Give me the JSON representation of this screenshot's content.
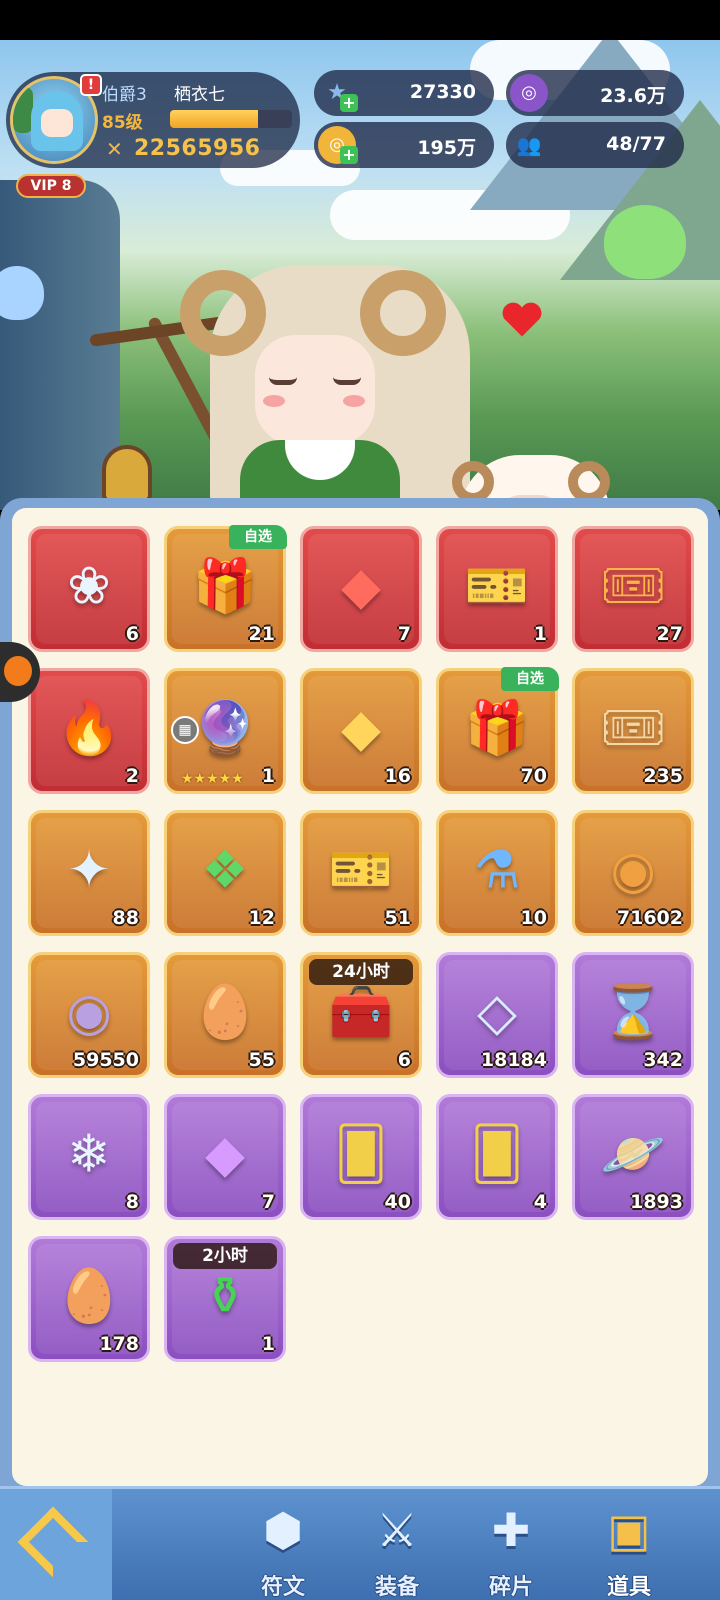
{
  "player": {
    "rank": "伯爵3",
    "name": "栖衣七",
    "level": "85级",
    "power": "22565956",
    "vip": "VIP 8",
    "alert": "!",
    "xp_fraction": 0.72
  },
  "currencies": [
    {
      "id": "star",
      "value": "27330",
      "icon": "star-gem-icon",
      "color": "#8ab8e8",
      "has_plus": true
    },
    {
      "id": "purple-coin",
      "value": "23.6万",
      "icon": "purple-coin-icon",
      "color": "#8a55c9",
      "has_plus": false
    },
    {
      "id": "gold",
      "value": "195万",
      "icon": "gold-coin-icon",
      "color": "#f1b53a",
      "has_plus": true
    },
    {
      "id": "friends",
      "value": "48/77",
      "icon": "people-icon",
      "color": "#e6eaf3",
      "has_plus": false
    }
  ],
  "items": [
    {
      "name": "lotus-gem",
      "glyph": "❀",
      "color": "#e9f4ff",
      "rarity": "red",
      "count": "6"
    },
    {
      "name": "crystal-gift-box",
      "glyph": "🎁",
      "color": "#ffe08a",
      "rarity": "gold",
      "count": "21",
      "tag": "自选"
    },
    {
      "name": "red-rune-crystal",
      "glyph": "◆",
      "color": "#ff6b5c",
      "rarity": "red",
      "count": "7"
    },
    {
      "name": "blue-ticket",
      "glyph": "🎫",
      "color": "#8ea0ff",
      "rarity": "red",
      "count": "1"
    },
    {
      "name": "sun-ticket",
      "glyph": "🎟",
      "color": "#ffb24a",
      "rarity": "red",
      "count": "27"
    },
    {
      "name": "fire-egg",
      "glyph": "🔥",
      "color": "#ff8a2a",
      "rarity": "red",
      "count": "2"
    },
    {
      "name": "crystal-ball",
      "glyph": "🔮",
      "color": "#ffd04a",
      "rarity": "gold",
      "count": "1",
      "stars": "★★★★★",
      "grid_button": true
    },
    {
      "name": "gold-rune-crystal",
      "glyph": "◆",
      "color": "#ffd55c",
      "rarity": "gold",
      "count": "16"
    },
    {
      "name": "crystal-gift-box-2",
      "glyph": "🎁",
      "color": "#ffe08a",
      "rarity": "gold",
      "count": "70",
      "tag": "自选"
    },
    {
      "name": "gold-ticket",
      "glyph": "🎟",
      "color": "#f3d7a6",
      "rarity": "gold",
      "count": "235"
    },
    {
      "name": "star-crystal",
      "glyph": "✦",
      "color": "#e4f1ff",
      "rarity": "gold",
      "count": "88"
    },
    {
      "name": "green-crystal",
      "glyph": "❖",
      "color": "#5fd86a",
      "rarity": "gold",
      "count": "12"
    },
    {
      "name": "heart-ticket",
      "glyph": "🎫",
      "color": "#7fe3e8",
      "rarity": "gold",
      "count": "51"
    },
    {
      "name": "potion-flask",
      "glyph": "⚗",
      "color": "#6fb8ff",
      "rarity": "gold",
      "count": "10"
    },
    {
      "name": "gold-medal-coin",
      "glyph": "◉",
      "color": "#f0a040",
      "rarity": "gold",
      "count": "71602"
    },
    {
      "name": "silver-coin",
      "glyph": "◉",
      "color": "#b9a0e0",
      "rarity": "gold",
      "count": "59550"
    },
    {
      "name": "swirl-egg",
      "glyph": "🥚",
      "color": "#d97a35",
      "rarity": "gold",
      "count": "55"
    },
    {
      "name": "treasure-chest",
      "glyph": "🧰",
      "color": "#e7a54a",
      "rarity": "gold",
      "count": "6",
      "timer": "24小时"
    },
    {
      "name": "diamond-gem",
      "glyph": "◇",
      "color": "#d9ebff",
      "rarity": "purple",
      "count": "18184"
    },
    {
      "name": "hourglass",
      "glyph": "⌛",
      "color": "#c8d7ff",
      "rarity": "purple",
      "count": "342"
    },
    {
      "name": "ice-crystals",
      "glyph": "❄",
      "color": "#e8f4ff",
      "rarity": "purple",
      "count": "8"
    },
    {
      "name": "purple-rune-crystal",
      "glyph": "◆",
      "color": "#d79bff",
      "rarity": "purple",
      "count": "7"
    },
    {
      "name": "sword-card",
      "glyph": "🂠",
      "color": "#f2cf48",
      "rarity": "purple",
      "count": "40"
    },
    {
      "name": "refresh-card",
      "glyph": "🂠",
      "color": "#f2cf48",
      "rarity": "purple",
      "count": "4"
    },
    {
      "name": "planet-orb",
      "glyph": "🪐",
      "color": "#78d6e0",
      "rarity": "purple",
      "count": "1893"
    },
    {
      "name": "purple-egg",
      "glyph": "🥚",
      "color": "#9b52e0",
      "rarity": "purple",
      "count": "178"
    },
    {
      "name": "green-potion",
      "glyph": "⚱",
      "color": "#45d454",
      "rarity": "purple",
      "count": "1",
      "timer": "2小时"
    }
  ],
  "nav": [
    {
      "id": "runes",
      "label": "符文",
      "glyph": "⬢",
      "active": false
    },
    {
      "id": "equipment",
      "label": "装备",
      "glyph": "⚔",
      "active": false
    },
    {
      "id": "fragments",
      "label": "碎片",
      "glyph": "✚",
      "active": false
    },
    {
      "id": "items",
      "label": "道具",
      "glyph": "▣",
      "active": true
    }
  ]
}
